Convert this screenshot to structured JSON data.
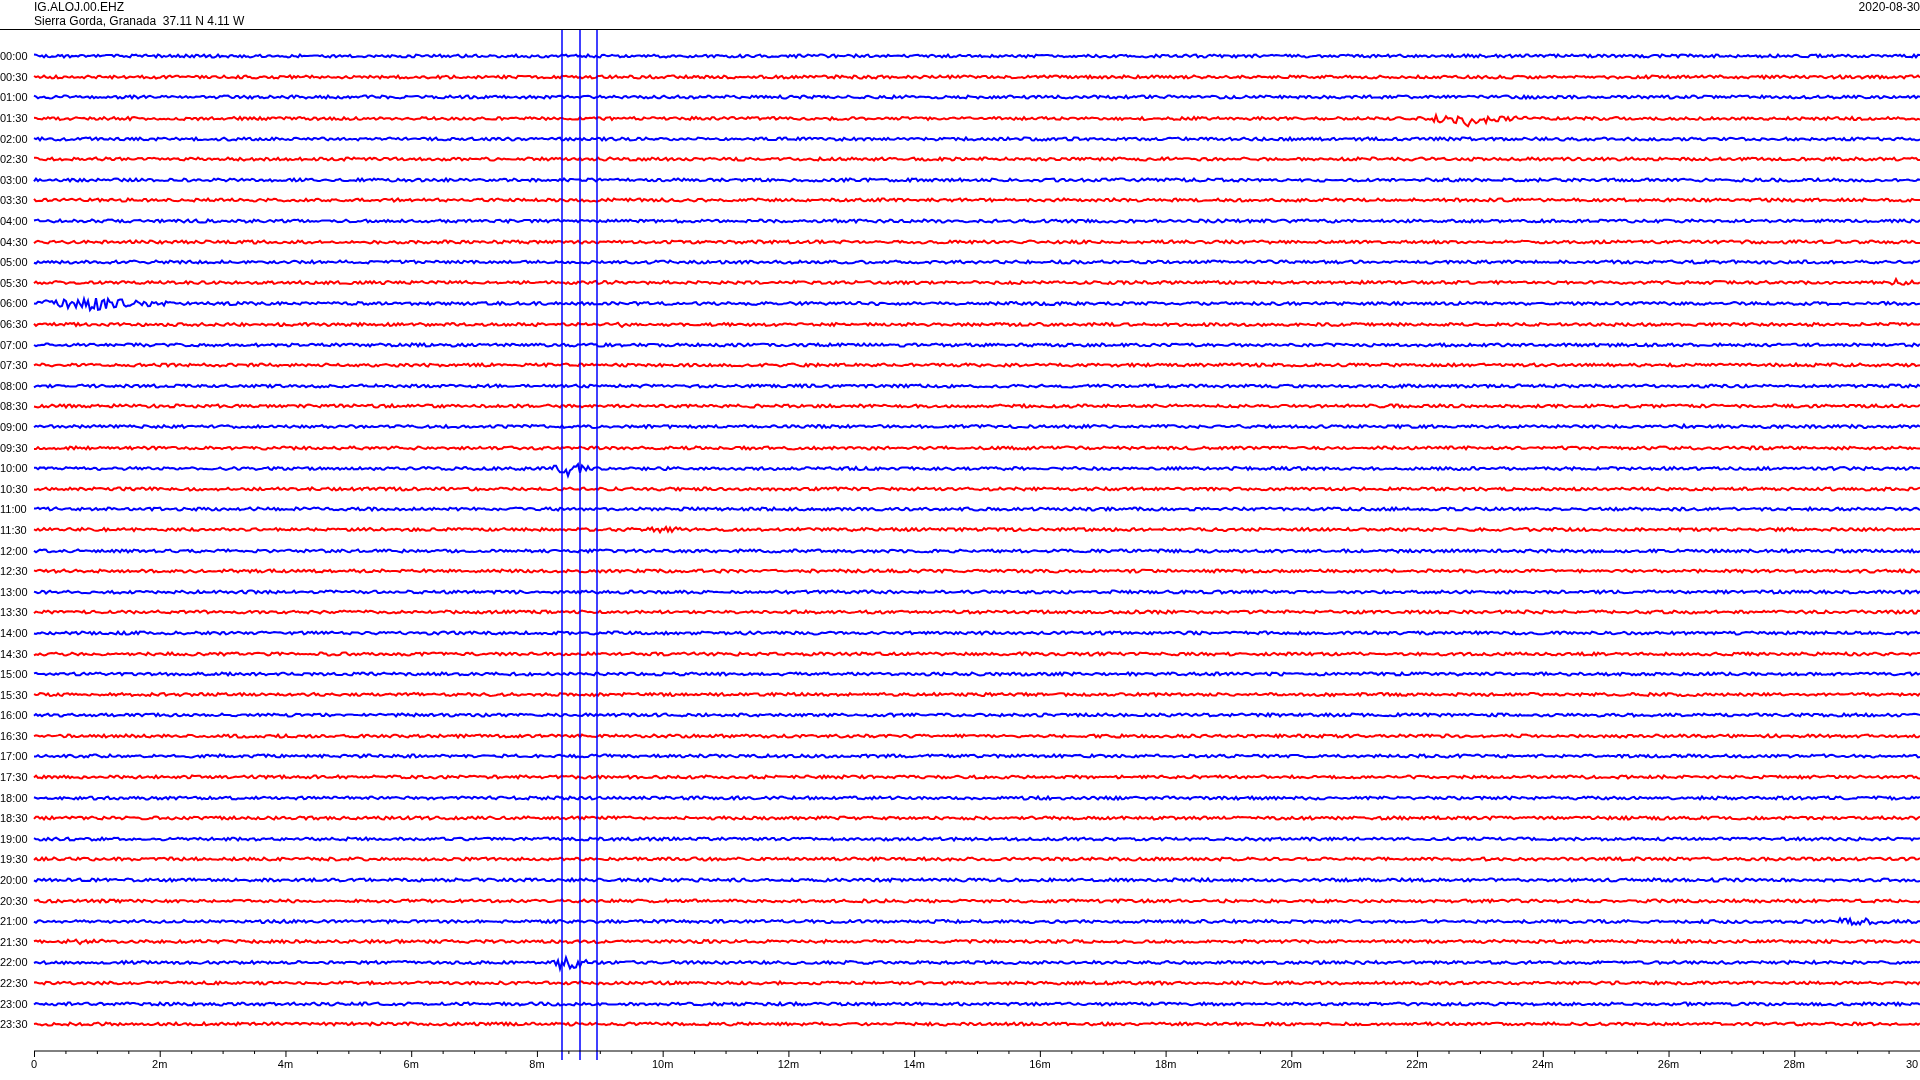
{
  "header": {
    "station": "IG.ALOJ.00.EHZ",
    "location": "Sierra Gorda, Granada  37.11 N 4.11 W",
    "date": "2020-08-30"
  },
  "rows": [
    {
      "time": "00:00",
      "color": "#0000ff"
    },
    {
      "time": "00:30",
      "color": "#ff0000"
    },
    {
      "time": "01:00",
      "color": "#0000ff"
    },
    {
      "time": "01:30",
      "color": "#ff0000"
    },
    {
      "time": "02:00",
      "color": "#0000ff"
    },
    {
      "time": "02:30",
      "color": "#ff0000"
    },
    {
      "time": "03:00",
      "color": "#0000ff"
    },
    {
      "time": "03:30",
      "color": "#ff0000"
    },
    {
      "time": "04:00",
      "color": "#0000ff"
    },
    {
      "time": "04:30",
      "color": "#ff0000"
    },
    {
      "time": "05:00",
      "color": "#0000ff"
    },
    {
      "time": "05:30",
      "color": "#ff0000"
    },
    {
      "time": "06:00",
      "color": "#0000ff"
    },
    {
      "time": "06:30",
      "color": "#ff0000"
    },
    {
      "time": "07:00",
      "color": "#0000ff"
    },
    {
      "time": "07:30",
      "color": "#ff0000"
    },
    {
      "time": "08:00",
      "color": "#0000ff"
    },
    {
      "time": "08:30",
      "color": "#ff0000"
    },
    {
      "time": "09:00",
      "color": "#0000ff"
    },
    {
      "time": "09:30",
      "color": "#ff0000"
    },
    {
      "time": "10:00",
      "color": "#0000ff"
    },
    {
      "time": "10:30",
      "color": "#ff0000"
    },
    {
      "time": "11:00",
      "color": "#0000ff"
    },
    {
      "time": "11:30",
      "color": "#ff0000"
    },
    {
      "time": "12:00",
      "color": "#0000ff"
    },
    {
      "time": "12:30",
      "color": "#ff0000"
    },
    {
      "time": "13:00",
      "color": "#0000ff"
    },
    {
      "time": "13:30",
      "color": "#ff0000"
    },
    {
      "time": "14:00",
      "color": "#0000ff"
    },
    {
      "time": "14:30",
      "color": "#ff0000"
    },
    {
      "time": "15:00",
      "color": "#0000ff"
    },
    {
      "time": "15:30",
      "color": "#ff0000"
    },
    {
      "time": "16:00",
      "color": "#0000ff"
    },
    {
      "time": "16:30",
      "color": "#ff0000"
    },
    {
      "time": "17:00",
      "color": "#0000ff"
    },
    {
      "time": "17:30",
      "color": "#ff0000"
    },
    {
      "time": "18:00",
      "color": "#0000ff"
    },
    {
      "time": "18:30",
      "color": "#ff0000"
    },
    {
      "time": "19:00",
      "color": "#0000ff"
    },
    {
      "time": "19:30",
      "color": "#ff0000"
    },
    {
      "time": "20:00",
      "color": "#0000ff"
    },
    {
      "time": "20:30",
      "color": "#ff0000"
    },
    {
      "time": "21:00",
      "color": "#0000ff"
    },
    {
      "time": "21:30",
      "color": "#ff0000"
    },
    {
      "time": "22:00",
      "color": "#0000ff"
    },
    {
      "time": "22:30",
      "color": "#ff0000"
    },
    {
      "time": "23:00",
      "color": "#0000ff"
    },
    {
      "time": "23:30",
      "color": "#ff0000"
    }
  ],
  "axis": {
    "ticks": [
      "0",
      "2m",
      "4m",
      "6m",
      "8m",
      "10m",
      "12m",
      "14m",
      "16m",
      "18m",
      "20m",
      "22m",
      "24m",
      "26m",
      "28m",
      "30"
    ]
  }
}
